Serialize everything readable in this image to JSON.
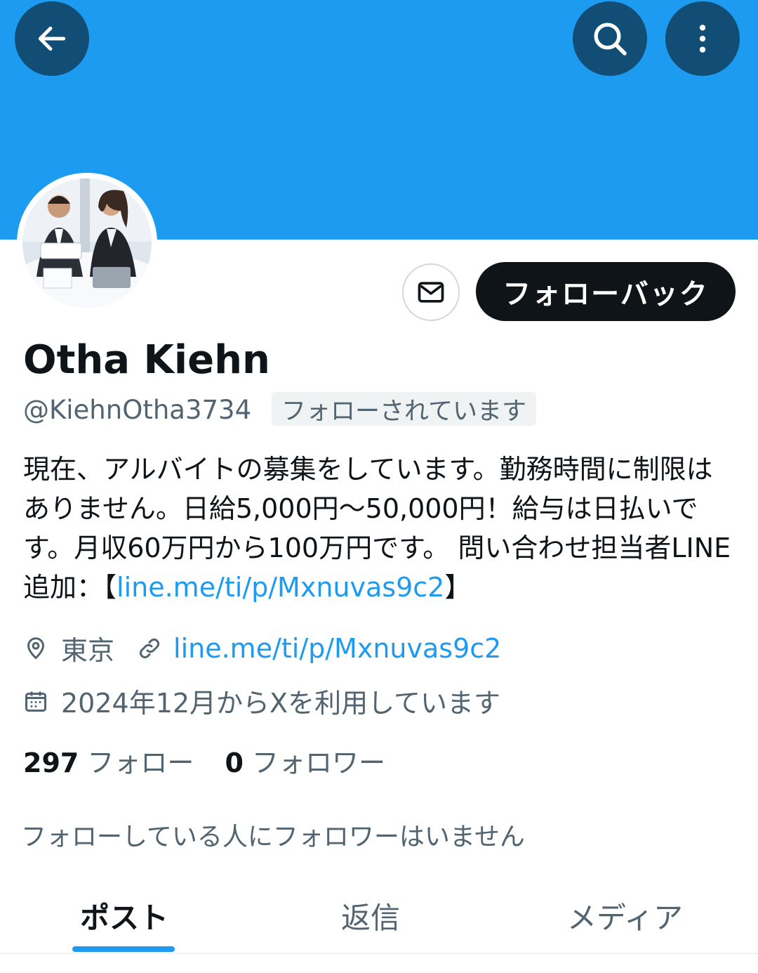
{
  "header": {
    "back_icon": "arrow-left-icon",
    "search_icon": "search-icon",
    "more_icon": "more-vertical-icon",
    "banner_color": "#1d9bf0"
  },
  "profile": {
    "name": "Otha Kiehn",
    "handle": "@KiehnOtha3734",
    "follows_you_badge": "フォローされています",
    "bio_text": "現在、アルバイトの募集をしています。勤務時間に制限はありません。日給5,000円～50,000円！給与は日払いです。月収60万円から100万円です。 問い合わせ担当者LINE追加：【",
    "bio_link": "line.me/ti/p/Mxnuvas9c2",
    "bio_suffix": "】",
    "location": "東京",
    "website": "line.me/ti/p/Mxnuvas9c2",
    "joined": "2024年12月からXを利用しています",
    "following_count": "297",
    "following_label": "フォロー",
    "followers_count": "0",
    "followers_label": "フォロワー",
    "mutuals_note": "フォローしている人にフォロワーはいません"
  },
  "actions": {
    "message_icon": "mail-icon",
    "follow_back_label": "フォローバック"
  },
  "tabs": [
    {
      "label": "ポスト",
      "active": true
    },
    {
      "label": "返信",
      "active": false
    },
    {
      "label": "メディア",
      "active": false
    }
  ],
  "colors": {
    "accent": "#1d9bf0",
    "text": "#0f1419",
    "muted": "#536471"
  }
}
